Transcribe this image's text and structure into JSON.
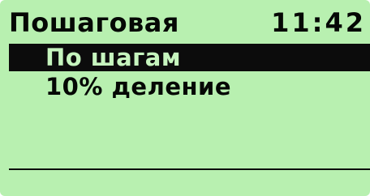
{
  "header": {
    "title": "Пошаговая",
    "time": "11:42"
  },
  "menu": {
    "items": [
      {
        "label": "По шагам",
        "selected": true
      },
      {
        "label": "10% деление",
        "selected": false
      }
    ]
  },
  "colors": {
    "screen_background": "#b8f0b0",
    "text": "#050805",
    "selection_background": "#0c0c0c",
    "selection_text": "#c6f5be"
  }
}
